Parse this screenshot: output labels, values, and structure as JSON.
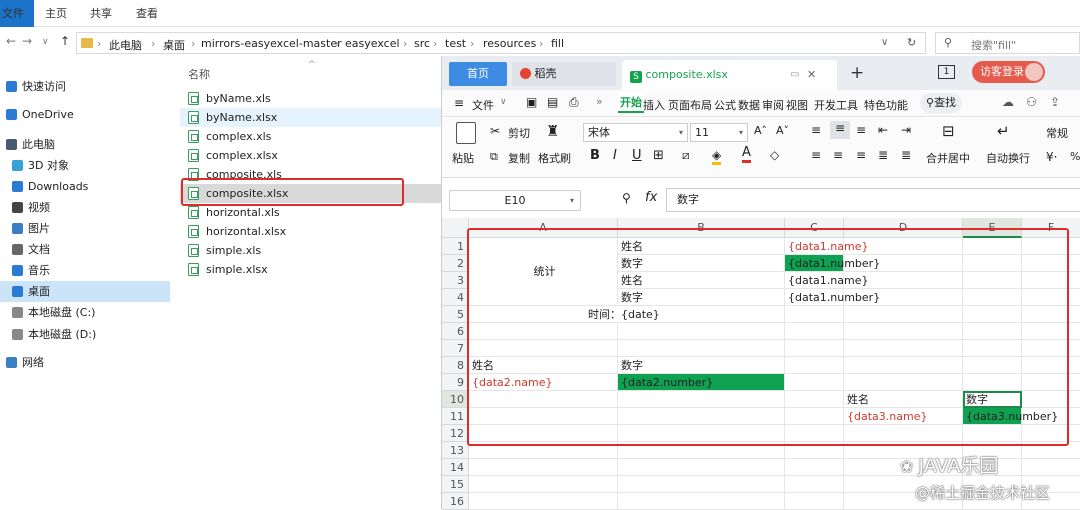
{
  "explorer": {
    "tabs": [
      "文件",
      "主页",
      "共享",
      "查看"
    ],
    "breadcrumb": [
      "此电脑",
      "桌面",
      "mirrors-easyexcel-master",
      "easyexcel",
      "src",
      "test",
      "resources",
      "fill"
    ],
    "search_placeholder": "搜索\"fill\"",
    "column_name": "名称",
    "nav": [
      {
        "label": "快速访问",
        "icon": "star-icon",
        "color": "#2a7bd4"
      },
      {
        "label": "OneDrive",
        "icon": "cloud-icon",
        "color": "#2a7bd4"
      },
      {
        "label": "此电脑",
        "icon": "computer-icon",
        "color": "#4a5a70"
      },
      {
        "label": "3D 对象",
        "icon": "cube-icon",
        "color": "#3aa0d8"
      },
      {
        "label": "Downloads",
        "icon": "download-icon",
        "color": "#2a7bd4"
      },
      {
        "label": "视频",
        "icon": "video-icon",
        "color": "#444"
      },
      {
        "label": "图片",
        "icon": "picture-icon",
        "color": "#3a7fc4"
      },
      {
        "label": "文档",
        "icon": "document-icon",
        "color": "#666"
      },
      {
        "label": "音乐",
        "icon": "music-icon",
        "color": "#2a7bd4"
      },
      {
        "label": "桌面",
        "icon": "desktop-icon",
        "color": "#2a7bd4"
      },
      {
        "label": "本地磁盘 (C:)",
        "icon": "disk-icon",
        "color": "#888"
      },
      {
        "label": "本地磁盘 (D:)",
        "icon": "disk-icon",
        "color": "#888"
      },
      {
        "label": "网络",
        "icon": "network-icon",
        "color": "#3a7fc4"
      }
    ],
    "files": [
      "byName.xls",
      "byName.xlsx",
      "complex.xls",
      "complex.xlsx",
      "composite.xls",
      "composite.xlsx",
      "horizontal.xls",
      "horizontal.xlsx",
      "simple.xls",
      "simple.xlsx"
    ],
    "selected_file": "composite.xlsx"
  },
  "wps": {
    "tabs": {
      "home": "首页",
      "docer": "稻壳",
      "doc": "composite.xlsx"
    },
    "visitor_login": "访客登录",
    "menu": {
      "file": "文件",
      "start": "开始",
      "insert": "插入",
      "layout": "页面布局",
      "formula": "公式",
      "data": "数据",
      "review": "审阅",
      "view": "视图",
      "dev": "开发工具",
      "special": "特色功能",
      "search": "查找"
    },
    "ribbon": {
      "paste": "粘贴",
      "cut": "剪切",
      "copy": "复制",
      "format_painter": "格式刷",
      "font": "宋体",
      "size": "11",
      "merge": "合并居中",
      "wrap": "自动换行",
      "number_format": "常规"
    },
    "namebox": "E10",
    "fx": "fx",
    "formula_value": "数字",
    "columns": [
      "A",
      "B",
      "C",
      "D",
      "E",
      "F"
    ],
    "rows": [
      "1",
      "2",
      "3",
      "4",
      "5",
      "6",
      "7",
      "8",
      "9",
      "10",
      "11",
      "12",
      "13",
      "14",
      "15",
      "16"
    ],
    "cells": {
      "a_stats": "统计",
      "b1": "姓名",
      "c1": "{data1.name}",
      "b2": "数字",
      "c2": "{data1.number}",
      "b3": "姓名",
      "c3": "{data1.name}",
      "b4": "数字",
      "c4": "{data1.number}",
      "b5": "时间：{date}",
      "a8": "姓名",
      "b8": "数字",
      "a9": "{data2.name}",
      "b9": "{data2.number}",
      "d10": "姓名",
      "e10": "数字",
      "d11": "{data3.name}",
      "e11": "{data3.number}"
    }
  },
  "watermarks": {
    "wechat": "JAVA乐园",
    "juejin": "@稀土掘金技术社区"
  },
  "colors": {
    "accent_green": "#0ea152",
    "highlight_red": "#e02b2b",
    "red_text": "#d03a2e",
    "explorer_blue": "#1a73c9"
  }
}
